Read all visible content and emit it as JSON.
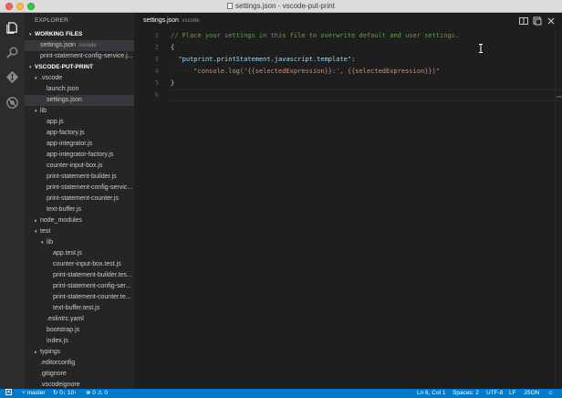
{
  "window": {
    "title": "settings.json - vscode-put-print"
  },
  "activity": [
    "files-icon",
    "search-icon",
    "git-icon",
    "debug-icon"
  ],
  "sidebar": {
    "title": "EXPLORER",
    "working_files_header": "WORKING FILES",
    "working_files": [
      {
        "name": "settings.json",
        "path": ".vscode"
      },
      {
        "name": "print-statement-config-service.j..."
      }
    ],
    "project_header": "VSCODE-PUT-PRINT",
    "tree": [
      {
        "label": ".vscode",
        "twisty": "▾"
      },
      {
        "label": "launch.json"
      },
      {
        "label": "settings.json"
      },
      {
        "label": "lib",
        "twisty": "▾"
      },
      {
        "label": "app.js"
      },
      {
        "label": "app-factory.js"
      },
      {
        "label": "app-integrator.js"
      },
      {
        "label": "app-integrator-factory.js"
      },
      {
        "label": "counter-input-box.js"
      },
      {
        "label": "print-statement-builder.js"
      },
      {
        "label": "print-statement-config-servic..."
      },
      {
        "label": "print-statement-counter.js"
      },
      {
        "label": "text-buffer.js"
      },
      {
        "label": "node_modules",
        "twisty": "▸"
      },
      {
        "label": "test",
        "twisty": "▾"
      },
      {
        "label": "lib",
        "twisty": "▾"
      },
      {
        "label": "app.test.js"
      },
      {
        "label": "counter-input-box.test.js"
      },
      {
        "label": "print-statement-builder.tes..."
      },
      {
        "label": "print-statement-config-ser..."
      },
      {
        "label": "print-statement-counter.te..."
      },
      {
        "label": "text-buffer.test.js"
      },
      {
        "label": ".eslintrc.yaml"
      },
      {
        "label": "bootstrap.js"
      },
      {
        "label": "index.js"
      },
      {
        "label": "typings",
        "twisty": "▸"
      },
      {
        "label": ".editorconfig"
      },
      {
        "label": ".gitignore"
      },
      {
        "label": ".vscodeignore"
      }
    ]
  },
  "editor": {
    "tab": {
      "name": "settings.json",
      "path": ".vscode"
    },
    "line_numbers": [
      "1",
      "2",
      "3",
      "4",
      "5",
      "6"
    ],
    "lines": {
      "l1_comment": "// Place your settings in this file to overwrite default and user settings.",
      "l2_brace": "{",
      "l3_indent": "··",
      "l3_key": "\"putprint.printStatement.javascript.template\"",
      "l3_colon": ":",
      "l4_indent": "······",
      "l4_value": "\"console.log('{{selectedExpression}}:', {{selectedExpression}})\"",
      "l5_brace": "}"
    }
  },
  "statusbar": {
    "branch": "master",
    "sync": "0↓ 10↑",
    "errors": "0",
    "warnings": "0",
    "position": "Ln 6, Col 1",
    "indent": "Spaces: 2",
    "encoding": "UTF-8",
    "eol": "LF",
    "language": "JSON"
  },
  "colors": {
    "statusbar": "#007acc",
    "sidebar": "#252526",
    "editor": "#1e1e1e",
    "activitybar": "#2c2c2c"
  }
}
